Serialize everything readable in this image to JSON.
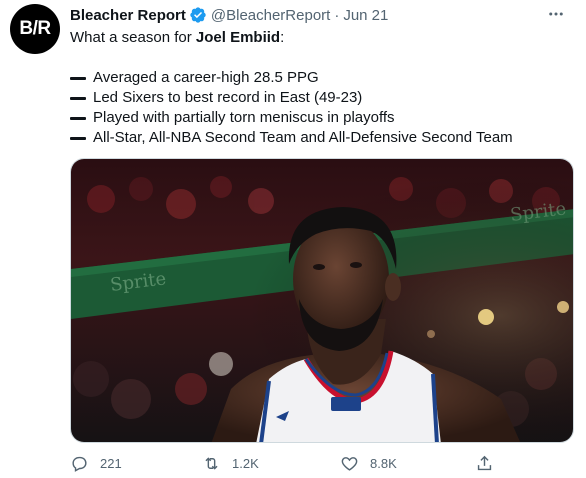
{
  "author": {
    "name": "Bleacher Report",
    "avatar_text": "B/R",
    "handle": "@BleacherReport",
    "separator": "·",
    "date": "Jun 21"
  },
  "tweet": {
    "intro_prefix": "What a season for ",
    "intro_bold": "Joel Embiid",
    "intro_suffix": ":",
    "bullets": [
      "Averaged a career-high 28.5 PPG",
      "Led Sixers to best record in East (49-23)",
      "Played with partially torn meniscus in playoffs",
      "All-Star, All-NBA Second Team and All-Defensive Second Team"
    ]
  },
  "actions": {
    "reply_count": "221",
    "retweet_count": "1.2K",
    "like_count": "8.8K"
  },
  "colors": {
    "verified": "#1d9bf0",
    "secondary_text": "#536471",
    "jersey_accent": "#1d428a"
  }
}
